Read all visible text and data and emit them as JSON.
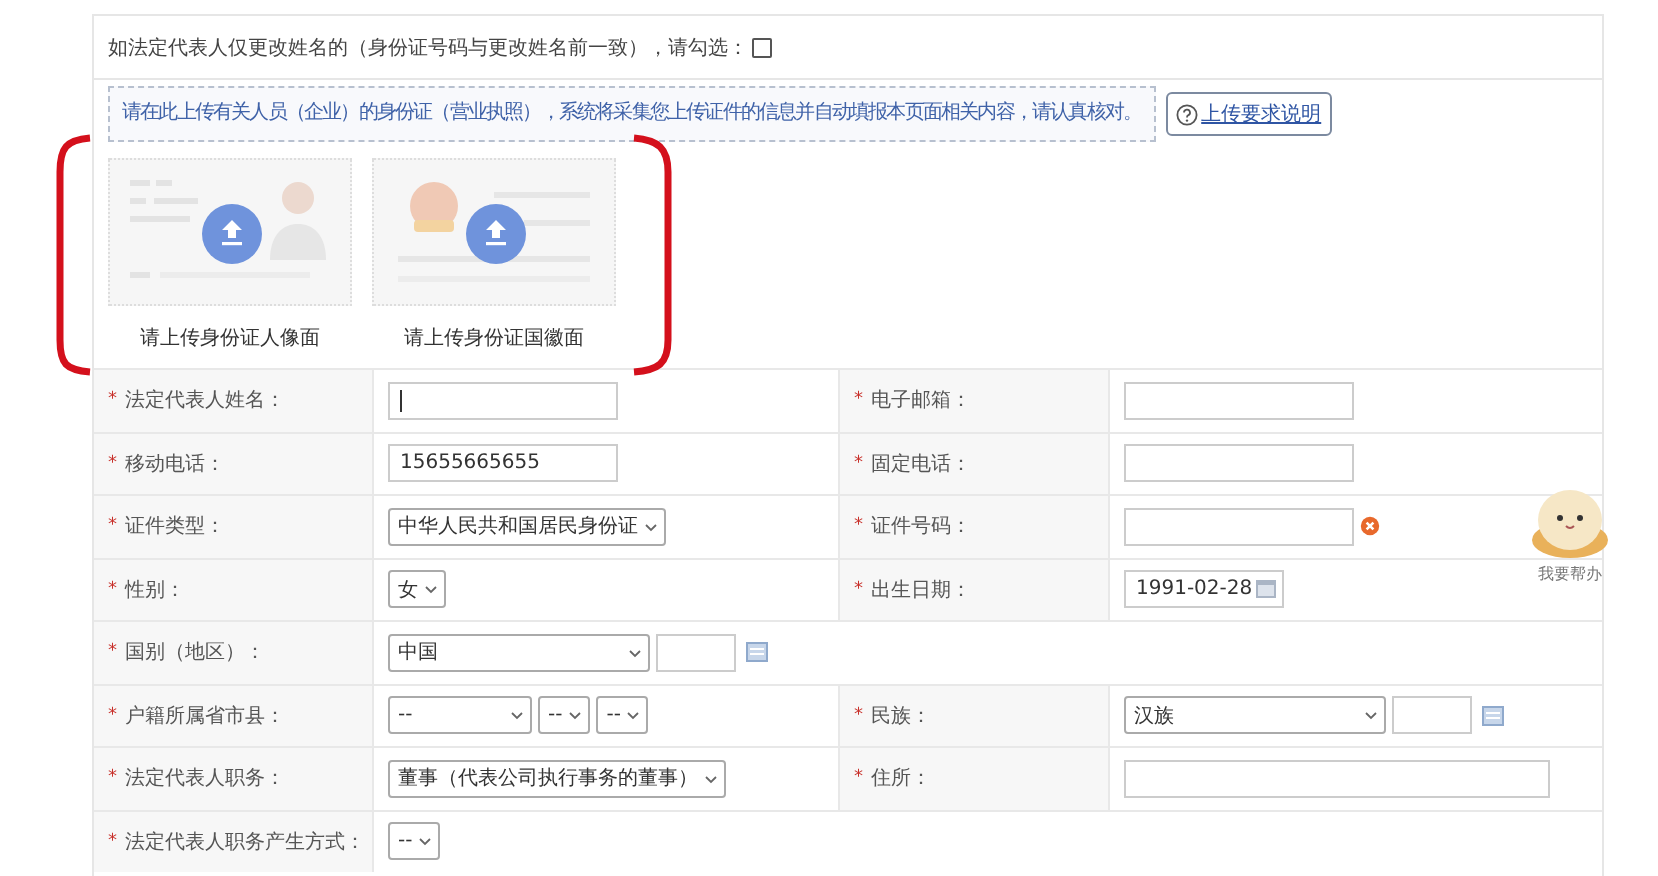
{
  "name_change": {
    "label": "如法定代表人仅更改姓名的（身份证号码与更改姓名前一致），请勾选：",
    "checked": false
  },
  "upload_notice": {
    "text": "请在此上传有关人员（企业）的身份证（营业执照），系统将采集您上传证件的信息并自动填报本页面相关内容，请认真核对。",
    "help_link": "上传要求说明"
  },
  "upload_cards": [
    {
      "kind": "portrait",
      "caption": "请上传身份证人像面"
    },
    {
      "kind": "emblem",
      "caption": "请上传身份证国徽面"
    }
  ],
  "form_rows": [
    {
      "fields": [
        {
          "mark": "*",
          "label": "法定代表人姓名：",
          "control": {
            "kind": "text",
            "focused": true
          }
        },
        {
          "mark": "*",
          "label": "电子邮箱：",
          "control": {
            "kind": "text"
          }
        }
      ]
    },
    {
      "fields": [
        {
          "mark": "*",
          "label": "移动电话：",
          "control": {
            "kind": "text",
            "value": "15655665655"
          }
        },
        {
          "mark": "*",
          "label": "固定电话：",
          "control": {
            "kind": "text"
          }
        }
      ]
    },
    {
      "fields": [
        {
          "mark": "*",
          "label": "证件类型：",
          "control": {
            "kind": "select",
            "value": "中华人民共和国居民身份证"
          }
        },
        {
          "mark": "*",
          "label": "证件号码：",
          "control": {
            "kind": "text",
            "error": true
          }
        }
      ]
    },
    {
      "fields": [
        {
          "mark": "*",
          "label": "性别：",
          "control": {
            "kind": "select",
            "value": "女"
          }
        },
        {
          "mark": "*",
          "label": "出生日期：",
          "control": {
            "kind": "date",
            "value": "1991-02-28"
          }
        }
      ]
    },
    {
      "fields": [
        {
          "mark": "*",
          "label": "国别（地区）：",
          "control": {
            "kind": "lookup",
            "value": "中国"
          }
        }
      ]
    },
    {
      "fields": [
        {
          "mark": "*",
          "label": "户籍所属省市县：",
          "control": {
            "kind": "select_group",
            "values": [
              "--",
              "--",
              "--"
            ]
          }
        },
        {
          "mark": "*",
          "label": "民族：",
          "control": {
            "kind": "lookup",
            "value": "汉族"
          }
        }
      ]
    },
    {
      "fields": [
        {
          "mark": "*",
          "label": "法定代表人职务：",
          "control": {
            "kind": "select",
            "value": "董事（代表公司执行事务的董事）"
          }
        },
        {
          "mark": "*",
          "label": "住所：",
          "control": {
            "kind": "wide_text"
          }
        }
      ]
    },
    {
      "fields": [
        {
          "mark": "*",
          "label": "法定代表人职务产生方式：",
          "control": {
            "kind": "select",
            "value": "--"
          }
        }
      ]
    }
  ],
  "helper": {
    "label": "我要帮办"
  }
}
